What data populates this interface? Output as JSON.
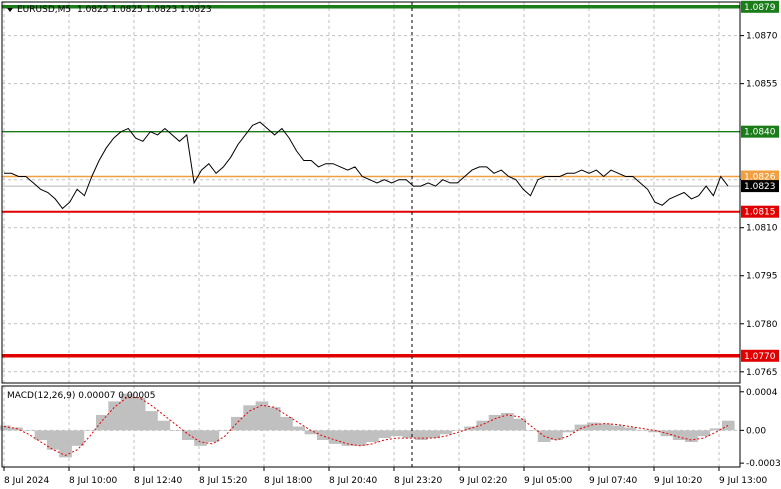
{
  "header": {
    "symbol": "EURUSD,M5",
    "ohlc": "1.0825 1.0825 1.0823 1.0823"
  },
  "macd": {
    "label": "MACD(12,26,9) 0.00007 0.00005",
    "axis_ticks": [
      "0.0004",
      "0.00",
      "-0.00034"
    ]
  },
  "colors": {
    "background": "#ffffff",
    "frame": "#000000",
    "grid": "#c0c0c0",
    "price_line": "#000000",
    "green_level": "#1a7d1a",
    "red_level": "#e00000",
    "bid_line": "#f0a040",
    "histogram": "#c0c0c0",
    "signal": "#e00000"
  },
  "chart_data": {
    "type": "line",
    "symbol": "EURUSD",
    "timeframe": "M5",
    "price_axis_ticks": [
      "1.0870",
      "1.0855",
      "1.0825",
      "1.0810",
      "1.0795",
      "1.0780",
      "1.0765"
    ],
    "time_axis_ticks": [
      "8 Jul 2024",
      "8 Jul 10:00",
      "8 Jul 12:40",
      "8 Jul 15:20",
      "8 Jul 18:00",
      "8 Jul 20:40",
      "8 Jul 23:20",
      "9 Jul 02:20",
      "9 Jul 05:00",
      "9 Jul 07:40",
      "9 Jul 10:20",
      "9 Jul 13:00"
    ],
    "ylim": [
      1.07615,
      1.08805
    ],
    "levels": [
      {
        "label": "1.0879",
        "price": 1.0879,
        "color": "green"
      },
      {
        "label": "1.0840",
        "price": 1.084,
        "color": "green"
      },
      {
        "label": "1.0826",
        "price": 1.0826,
        "color": "orange"
      },
      {
        "label": "1.0823",
        "price": 1.0823,
        "color": "black"
      },
      {
        "label": "1.0815",
        "price": 1.0815,
        "color": "red"
      },
      {
        "label": "1.0770",
        "price": 1.077,
        "color": "red"
      }
    ],
    "separator_after_tick": 6,
    "price_series": [
      1.0827,
      1.0827,
      1.0826,
      1.0826,
      1.0824,
      1.0822,
      1.0821,
      1.0819,
      1.0816,
      1.0818,
      1.0822,
      1.082,
      1.0826,
      1.0831,
      1.0835,
      1.0838,
      1.084,
      1.0841,
      1.0838,
      1.0837,
      1.084,
      1.0839,
      1.0841,
      1.0839,
      1.0837,
      1.0839,
      1.0824,
      1.0828,
      1.083,
      1.0827,
      1.0829,
      1.0832,
      1.0836,
      1.0839,
      1.0842,
      1.0843,
      1.0841,
      1.0839,
      1.0841,
      1.0838,
      1.0834,
      1.0831,
      1.0831,
      1.0829,
      1.083,
      1.083,
      1.0829,
      1.0828,
      1.0829,
      1.0826,
      1.0825,
      1.0824,
      1.0825,
      1.0824,
      1.0825,
      1.0825,
      1.0823,
      1.0823,
      1.0824,
      1.0823,
      1.0825,
      1.0824,
      1.0824,
      1.0826,
      1.0828,
      1.0829,
      1.0829,
      1.0827,
      1.0828,
      1.0826,
      1.0825,
      1.0822,
      1.082,
      1.0825,
      1.0826,
      1.0826,
      1.0826,
      1.0827,
      1.0827,
      1.0828,
      1.0827,
      1.0828,
      1.0826,
      1.0828,
      1.0827,
      1.0826,
      1.0826,
      1.0824,
      1.0822,
      1.0818,
      1.0817,
      1.0819,
      1.082,
      1.0821,
      1.0819,
      1.082,
      1.0823,
      1.082,
      1.0826,
      1.0823
    ],
    "macd_histogram": [
      5e-05,
      3e-05,
      0.0,
      -0.0001,
      -0.0002,
      -0.00028,
      -0.00016,
      0.0,
      0.00016,
      0.0003,
      0.00038,
      0.00034,
      0.0002,
      0.0001,
      0.0,
      -0.0001,
      -0.00016,
      -0.00012,
      0.0,
      0.00014,
      0.00026,
      0.0003,
      0.00024,
      0.00014,
      4e-05,
      -4e-05,
      -0.0001,
      -0.00014,
      -0.00016,
      -0.00016,
      -0.00012,
      -8e-05,
      -6e-05,
      -8e-05,
      -0.0001,
      -8e-05,
      -4e-05,
      0.0,
      4e-05,
      0.0001,
      0.00016,
      0.00018,
      0.00012,
      0.0,
      -0.00012,
      -0.0001,
      -2e-05,
      6e-05,
      8e-05,
      7e-05,
      5e-05,
      3e-05,
      0.0,
      -2e-05,
      -6e-05,
      -0.0001,
      -0.00012,
      -6e-05,
      2e-05,
      0.0001
    ],
    "macd_signal": [
      4e-05,
      2e-05,
      -4e-05,
      -0.00012,
      -0.0002,
      -0.00026,
      -0.0002,
      -6e-05,
      0.0001,
      0.00024,
      0.00034,
      0.00034,
      0.00026,
      0.00016,
      6e-05,
      -4e-05,
      -0.00012,
      -0.00014,
      -6e-05,
      8e-05,
      0.0002,
      0.00026,
      0.00024,
      0.00016,
      8e-05,
      0.0,
      -6e-05,
      -0.0001,
      -0.00014,
      -0.00016,
      -0.00014,
      -0.0001,
      -8e-05,
      -8e-05,
      -8e-05,
      -8e-05,
      -6e-05,
      -2e-05,
      2e-05,
      6e-05,
      0.00012,
      0.00016,
      0.00014,
      4e-05,
      -6e-05,
      -0.0001,
      -6e-05,
      2e-05,
      6e-05,
      7e-05,
      6e-05,
      4e-05,
      2e-05,
      0.0,
      -3e-05,
      -7e-05,
      -0.0001,
      -8e-05,
      -2e-05,
      5e-05
    ],
    "macd_ylim": [
      -0.00038,
      0.00046
    ]
  }
}
